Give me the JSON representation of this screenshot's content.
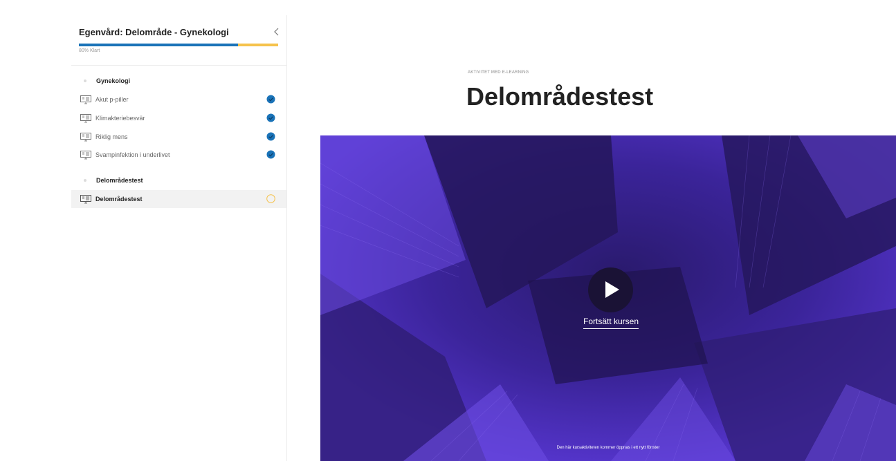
{
  "sidebar": {
    "course_title": "Egenvård: Delområde - Gynekologi",
    "progress_percent": 80,
    "progress_text": "80% Klart",
    "collapse_icon": "chevron-left-icon",
    "sections": [
      {
        "title": "Gynekologi"
      },
      {
        "title": "Delområdestest"
      }
    ],
    "lessons": [
      {
        "label": "Akut p-piller",
        "status": "completed"
      },
      {
        "label": "Klimakteriebesvär",
        "status": "completed"
      },
      {
        "label": "Riklig mens",
        "status": "completed"
      },
      {
        "label": "Svampinfektion i underlivet",
        "status": "completed"
      },
      {
        "label": "Delområdestest",
        "status": "in-progress"
      }
    ]
  },
  "main": {
    "eyebrow": "AKTIVITET MED E-LEARNING",
    "title": "Delområdestest",
    "hero": {
      "continue_label": "Fortsätt kursen",
      "note": "Den här kursaktiviteten kommer öppnas i ett nytt fönster"
    }
  },
  "colors": {
    "progress_done": "#1a73b8",
    "progress_remaining": "#f5c24c",
    "completed_check": "#1a73b8",
    "in_progress_ring": "#f5c24c",
    "hero_purple": "#4a2fb3"
  }
}
